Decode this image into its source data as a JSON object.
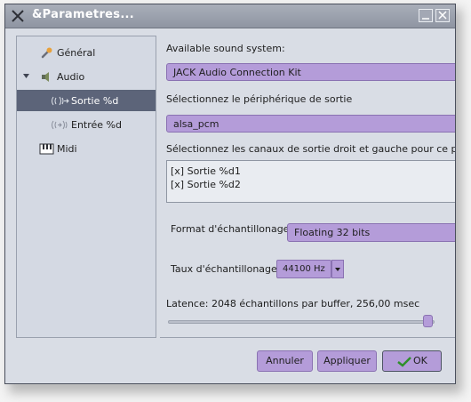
{
  "window": {
    "title": "&Parametres..."
  },
  "sidebar": {
    "items": [
      {
        "label": "Général",
        "icon": "wrench-icon"
      },
      {
        "label": "Audio",
        "icon": "audio-speaker-icon",
        "expanded": true
      },
      {
        "label": "Sortie %d",
        "icon": "sound-out-icon",
        "selected": true
      },
      {
        "label": "Entrée %d",
        "icon": "sound-in-icon"
      },
      {
        "label": "Midi",
        "icon": "midi-keyboard-icon"
      }
    ]
  },
  "audio": {
    "system_label": "Available sound system:",
    "system_value": "JACK Audio Connection Kit",
    "device_label": "Sélectionnez le périphérique de sortie",
    "device_value": "alsa_pcm",
    "channels_label": "Sélectionnez les canaux de sortie droit et gauche pour ce périphé",
    "channels": [
      "[x] Sortie %d1",
      "[x] Sortie %d2"
    ],
    "format_label": "Format d'échantillonage",
    "format_value": "Floating 32 bits",
    "rate_label": "Taux d'échantillonage",
    "rate_value": "44100 Hz",
    "latency_text": "Latence: 2048 échantillons par buffer, 256,00 msec",
    "latency_level": 0.98
  },
  "buttons": {
    "cancel": "Annuler",
    "apply": "Appliquer",
    "ok": "OK"
  },
  "colors": {
    "field": "#b49cd9",
    "selection": "#5c6479",
    "titlebar": "#9a9fac"
  }
}
